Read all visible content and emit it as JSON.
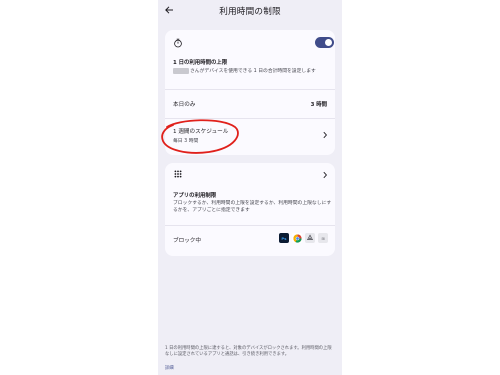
{
  "header": {
    "title": "利用時間の制限"
  },
  "limit_card": {
    "toggle_on": true,
    "title": "1 日の利用時間の上限",
    "description": "さんがデバイスを使用できる 1 日の合計時間を設定します",
    "today_label": "本日のみ",
    "today_value": "3 時間",
    "schedule_title": "1 週間のスケジュール",
    "schedule_sub": "毎日 3 時間"
  },
  "apps_card": {
    "title": "アプリの利用制限",
    "description": "ブロックするか、利用時間の上限を設定するか、利用時間の上限なしにするかを、アプリごとに指定できます",
    "blocked_label": "ブロック中",
    "blocked_apps": [
      "photoshop-icon",
      "chrome-icon",
      "recycle-app-icon",
      "app-icon"
    ],
    "ps_label": "Ps",
    "app4_label": "⊞"
  },
  "footer": {
    "note": "1 日の利用時間の上限に達すると、対象のデバイスがロックされます。利用時間の上限なしに設定されているアプリと通話は、引き続き利用できます。",
    "link": "詳細"
  },
  "colors": {
    "accent": "#404c8a",
    "annotation": "#e0201b",
    "background": "#efeef6",
    "card": "#fbfaff"
  }
}
